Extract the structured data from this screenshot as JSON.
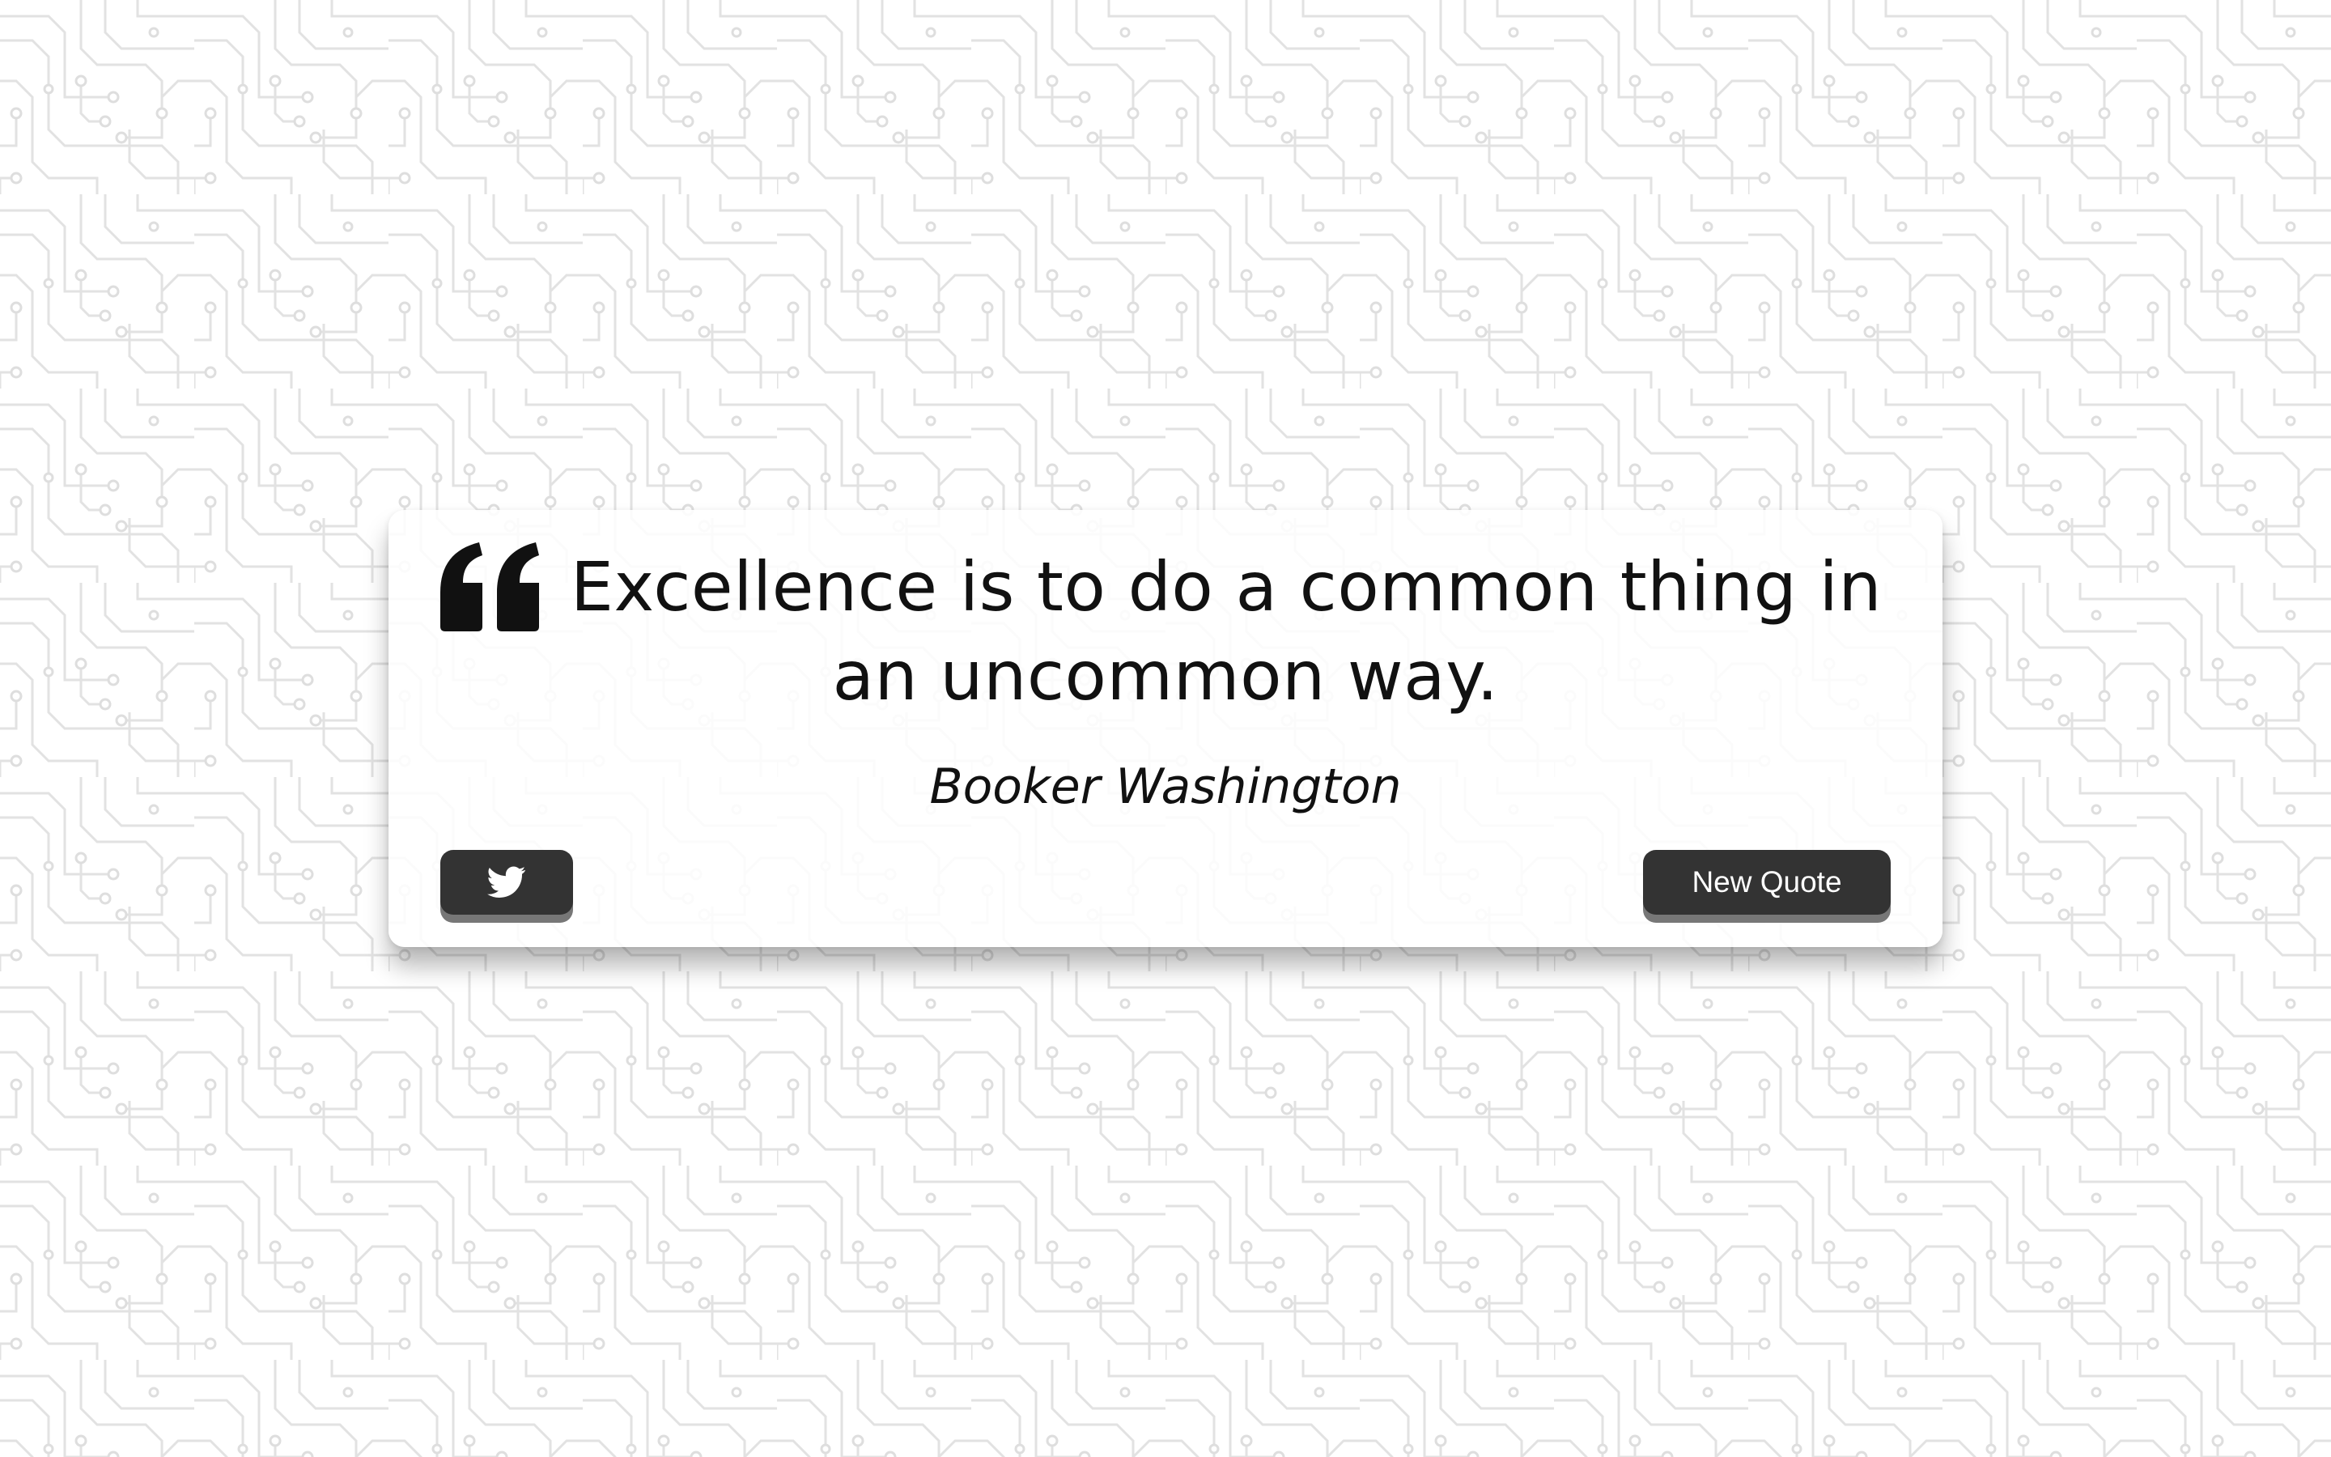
{
  "quote": {
    "text": "Excellence is to do a common thing in an uncommon way.",
    "author": "Booker Washington"
  },
  "buttons": {
    "twitter_icon": "twitter-icon",
    "new_quote_label": "New Quote"
  },
  "colors": {
    "background": "#ffffff",
    "circuit_pattern": "#e4e4e4",
    "button": "#333333",
    "button_text": "#ffffff",
    "text": "#111111"
  }
}
